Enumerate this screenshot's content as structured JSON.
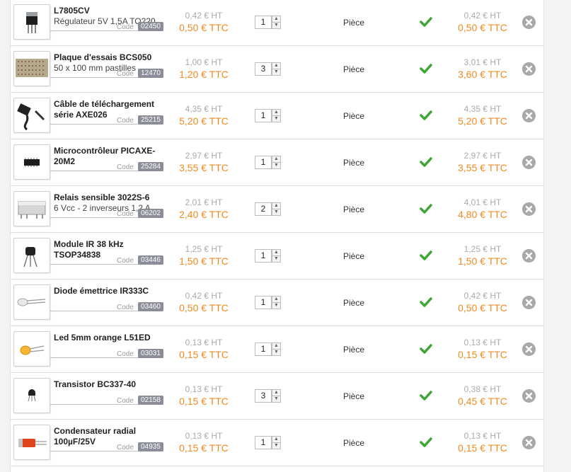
{
  "cart": {
    "code_label": "Code",
    "items": [
      {
        "name": "L7805CV",
        "desc": "Régulateur 5V 1,5A TO220",
        "code": "02450",
        "unit_ht": "0,42 € HT",
        "unit_ttc": "0,50 € TTC",
        "qty": "1",
        "unit": "Pièce",
        "total_ht": "0,42 € HT",
        "total_ttc": "0,50 € TTC",
        "icon": "regulator-icon"
      },
      {
        "name": "Plaque d'essais BCS050",
        "desc": "50 x 100 mm pastilles",
        "code": "12470",
        "unit_ht": "1,00 € HT",
        "unit_ttc": "1,20 € TTC",
        "qty": "3",
        "unit": "Pièce",
        "total_ht": "3,01 € HT",
        "total_ttc": "3,60 € TTC",
        "icon": "breadboard-icon"
      },
      {
        "name": "Câble de téléchargement série AXE026",
        "desc": "",
        "code": "25215",
        "unit_ht": "4,35 € HT",
        "unit_ttc": "5,20 € TTC",
        "qty": "1",
        "unit": "Pièce",
        "total_ht": "4,35 € HT",
        "total_ttc": "5,20 € TTC",
        "icon": "serial-cable-icon"
      },
      {
        "name": "Microcontrôleur PICAXE-20M2",
        "desc": "",
        "code": "25284",
        "unit_ht": "2,97 € HT",
        "unit_ttc": "3,55 € TTC",
        "qty": "1",
        "unit": "Pièce",
        "total_ht": "2,97 € HT",
        "total_ttc": "3,55 € TTC",
        "icon": "chip-icon"
      },
      {
        "name": "Relais sensible 3022S-6",
        "desc": "6 Vcc - 2 inverseurs 1,2 A",
        "code": "06202",
        "unit_ht": "2,01 € HT",
        "unit_ttc": "2,40 € TTC",
        "qty": "2",
        "unit": "Pièce",
        "total_ht": "4,01 € HT",
        "total_ttc": "4,80 € TTC",
        "icon": "relay-icon"
      },
      {
        "name": "Module IR 38 kHz TSOP34838",
        "desc": "",
        "code": "03446",
        "unit_ht": "1,25 € HT",
        "unit_ttc": "1,50 € TTC",
        "qty": "1",
        "unit": "Pièce",
        "total_ht": "1,25 € HT",
        "total_ttc": "1,50 € TTC",
        "icon": "ir-module-icon"
      },
      {
        "name": "Diode émettrice IR333C",
        "desc": "",
        "code": "03460",
        "unit_ht": "0,42 € HT",
        "unit_ttc": "0,50 € TTC",
        "qty": "1",
        "unit": "Pièce",
        "total_ht": "0,42 € HT",
        "total_ttc": "0,50 € TTC",
        "icon": "ir-diode-icon"
      },
      {
        "name": "Led 5mm orange L51ED",
        "desc": "",
        "code": "03031",
        "unit_ht": "0,13 € HT",
        "unit_ttc": "0,15 € TTC",
        "qty": "1",
        "unit": "Pièce",
        "total_ht": "0,13 € HT",
        "total_ttc": "0,15 € TTC",
        "icon": "led-icon"
      },
      {
        "name": "Transistor BC337-40",
        "desc": "",
        "code": "02158",
        "unit_ht": "0,13 € HT",
        "unit_ttc": "0,15 € TTC",
        "qty": "3",
        "unit": "Pièce",
        "total_ht": "0,38 € HT",
        "total_ttc": "0,45 € TTC",
        "icon": "transistor-icon"
      },
      {
        "name": "Condensateur radial 100µF/25V",
        "desc": "",
        "code": "04935",
        "unit_ht": "0,13 € HT",
        "unit_ttc": "0,15 € TTC",
        "qty": "1",
        "unit": "Pièce",
        "total_ht": "0,13 € HT",
        "total_ttc": "0,15 € TTC",
        "icon": "capacitor-icon"
      }
    ]
  },
  "colors": {
    "ttc": "#f08a1e",
    "ht": "#aaaaaa",
    "check": "#3fa535",
    "badge": "#8b8d99",
    "remove": "#a9a9a9"
  }
}
